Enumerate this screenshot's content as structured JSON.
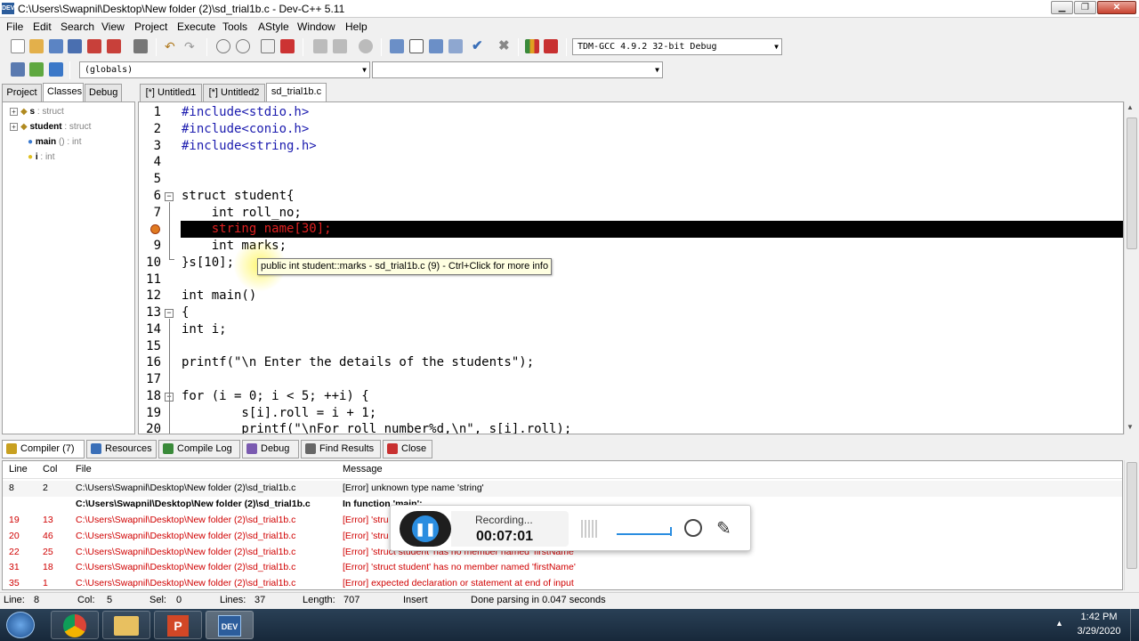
{
  "window": {
    "title": "C:\\Users\\Swapnil\\Desktop\\New folder (2)\\sd_trial1b.c - Dev-C++ 5.11",
    "app_icon_text": "DEV"
  },
  "menu": [
    "File",
    "Edit",
    "Search",
    "View",
    "Project",
    "Execute",
    "Tools",
    "AStyle",
    "Window",
    "Help"
  ],
  "toolbar": {
    "compiler_select": "TDM-GCC 4.9.2 32-bit Debug",
    "scope_select": "(globals)",
    "member_select": ""
  },
  "left_tabs": [
    "Project",
    "Classes",
    "Debug"
  ],
  "left_active_tab": "Classes",
  "class_tree": [
    {
      "name": "s",
      "type": " : struct",
      "expandable": true
    },
    {
      "name": "student",
      "type": " : struct",
      "expandable": true
    },
    {
      "name": "main",
      "type": " () : int",
      "expandable": false
    },
    {
      "name": "i",
      "type": " : int",
      "expandable": false
    }
  ],
  "editor_tabs": [
    "[*] Untitled1",
    "[*] Untitled2",
    "sd_trial1b.c"
  ],
  "editor_active_tab": "sd_trial1b.c",
  "code_lines": [
    {
      "n": "1",
      "text": "#include<stdio.h>"
    },
    {
      "n": "2",
      "text": "#include<conio.h>"
    },
    {
      "n": "3",
      "text": "#include<string.h>"
    },
    {
      "n": "4",
      "text": ""
    },
    {
      "n": "5",
      "text": ""
    },
    {
      "n": "6",
      "text": "struct student{"
    },
    {
      "n": "7",
      "text": "    int roll_no;"
    },
    {
      "n": "",
      "text": "    string name[30];"
    },
    {
      "n": "9",
      "text": "    int marks;"
    },
    {
      "n": "10",
      "text": "}s[10];"
    },
    {
      "n": "11",
      "text": ""
    },
    {
      "n": "12",
      "text": "int main()"
    },
    {
      "n": "13",
      "text": "{"
    },
    {
      "n": "14",
      "text": "int i;"
    },
    {
      "n": "15",
      "text": ""
    },
    {
      "n": "16",
      "text": "printf(\"\\n Enter the details of the students\");"
    },
    {
      "n": "17",
      "text": ""
    },
    {
      "n": "18",
      "text": "for (i = 0; i < 5; ++i) {"
    },
    {
      "n": "19",
      "text": "        s[i].roll = i + 1;"
    },
    {
      "n": "20",
      "text": "        printf(\"\\nFor roll number%d,\\n\", s[i].roll);"
    }
  ],
  "tooltip": "public int student::marks - sd_trial1b.c (9) - Ctrl+Click for more info",
  "bottom_tabs": [
    "Compiler (7)",
    "Resources",
    "Compile Log",
    "Debug",
    "Find Results",
    "Close"
  ],
  "messages": {
    "headers": {
      "line": "Line",
      "col": "Col",
      "file": "File",
      "message": "Message"
    },
    "rows": [
      {
        "line": "8",
        "col": "2",
        "file": "C:\\Users\\Swapnil\\Desktop\\New folder (2)\\sd_trial1b.c",
        "message": "[Error] unknown type name 'string'",
        "style": "sel"
      },
      {
        "line": "",
        "col": "",
        "file": "C:\\Users\\Swapnil\\Desktop\\New folder (2)\\sd_trial1b.c",
        "message": "In function 'main':",
        "style": "bold"
      },
      {
        "line": "19",
        "col": "13",
        "file": "C:\\Users\\Swapnil\\Desktop\\New folder (2)\\sd_trial1b.c",
        "message": "[Error] 'stru",
        "style": "red"
      },
      {
        "line": "20",
        "col": "46",
        "file": "C:\\Users\\Swapnil\\Desktop\\New folder (2)\\sd_trial1b.c",
        "message": "[Error] 'stru",
        "style": "red"
      },
      {
        "line": "22",
        "col": "25",
        "file": "C:\\Users\\Swapnil\\Desktop\\New folder (2)\\sd_trial1b.c",
        "message": "[Error] 'struct student' has no member named 'firstName'",
        "style": "red"
      },
      {
        "line": "31",
        "col": "18",
        "file": "C:\\Users\\Swapnil\\Desktop\\New folder (2)\\sd_trial1b.c",
        "message": "[Error] 'struct student' has no member named 'firstName'",
        "style": "red"
      },
      {
        "line": "35",
        "col": "1",
        "file": "C:\\Users\\Swapnil\\Desktop\\New folder (2)\\sd_trial1b.c",
        "message": "[Error] expected declaration or statement at end of input",
        "style": "red"
      }
    ]
  },
  "status": {
    "line_label": "Line:",
    "line": "8",
    "col_label": "Col:",
    "col": "5",
    "sel_label": "Sel:",
    "sel": "0",
    "lines_label": "Lines:",
    "lines": "37",
    "length_label": "Length:",
    "length": "707",
    "mode": "Insert",
    "parse": "Done parsing in 0.047 seconds"
  },
  "recorder": {
    "status": "Recording...",
    "time": "00:07:01"
  },
  "clock": {
    "time": "1:42 PM",
    "date": "3/29/2020"
  },
  "colors": {
    "keyword": "#1c1caf",
    "error_text": "#d00000",
    "highlight_line": "#000000",
    "accent": "#2a8de0"
  }
}
